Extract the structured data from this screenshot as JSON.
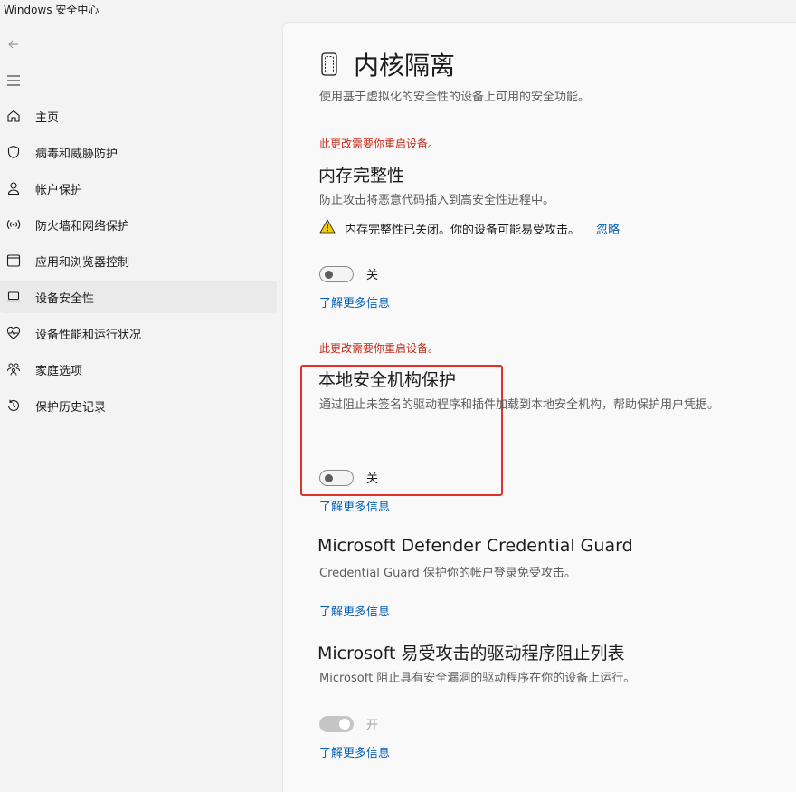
{
  "window": {
    "title": "Windows 安全中心"
  },
  "nav": {
    "back_icon": "arrow-left-icon",
    "menu_icon": "hamburger-icon",
    "items": [
      {
        "label": "主页",
        "icon": "home-icon"
      },
      {
        "label": "病毒和威胁防护",
        "icon": "shield-icon"
      },
      {
        "label": "帐户保护",
        "icon": "person-icon"
      },
      {
        "label": "防火墙和网络保护",
        "icon": "wireless-icon"
      },
      {
        "label": "应用和浏览器控制",
        "icon": "browser-window-icon"
      },
      {
        "label": "设备安全性",
        "icon": "laptop-icon",
        "selected": true
      },
      {
        "label": "设备性能和运行状况",
        "icon": "heart-pulse-icon"
      },
      {
        "label": "家庭选项",
        "icon": "family-icon"
      },
      {
        "label": "保护历史记录",
        "icon": "history-icon"
      }
    ]
  },
  "page": {
    "icon": "core-isolation-chip-icon",
    "title": "内核隔离",
    "description": "使用基于虚拟化的安全性的设备上可用的安全功能。"
  },
  "memory_integrity": {
    "restart_notice": "此更改需要你重启设备。",
    "title": "内存完整性",
    "description": "防止攻击将恶意代码插入到高安全性进程中。",
    "warning_icon": "warning-triangle-icon",
    "warning": "内存完整性已关闭。你的设备可能易受攻击。",
    "dismiss": "忽略",
    "toggle_label": "关",
    "toggle_on": false,
    "learn_more": "了解更多信息"
  },
  "lsa_protection": {
    "restart_notice": "此更改需要你重启设备。",
    "title": "本地安全机构保护",
    "description": "通过阻止未签名的驱动程序和插件加载到本地安全机构，帮助保护用户凭据。",
    "toggle_label": "关",
    "toggle_on": false,
    "learn_more": "了解更多信息"
  },
  "credential_guard": {
    "title": "Microsoft Defender Credential Guard",
    "description": "Credential Guard 保护你的帐户登录免受攻击。",
    "learn_more": "了解更多信息"
  },
  "driver_blocklist": {
    "title": "Microsoft 易受攻击的驱动程序阻止列表",
    "description": "Microsoft 阻止具有安全漏洞的驱动程序在你的设备上运行。",
    "toggle_label": "开",
    "toggle_on": true,
    "toggle_disabled": true,
    "learn_more": "了解更多信息"
  },
  "colors": {
    "accent_link": "#005fb8",
    "restart_red": "#c42b1c",
    "highlight_red": "#e0302a",
    "warning_yellow": "#f2c811"
  }
}
